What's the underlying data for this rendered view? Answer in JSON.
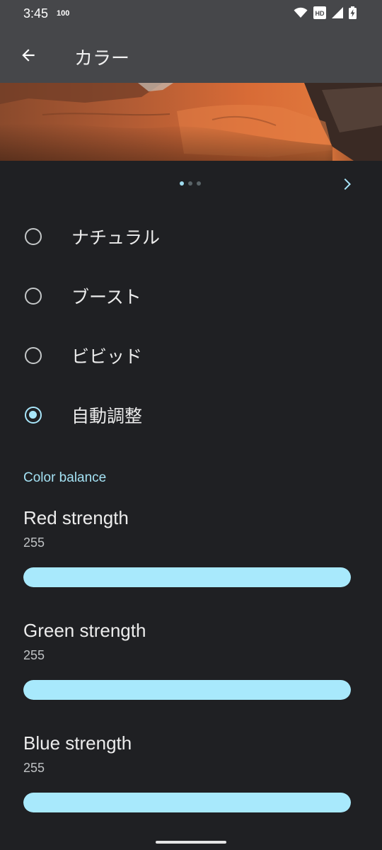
{
  "status_bar": {
    "time": "3:45",
    "battery_percent": "100",
    "icons": [
      "wifi-icon",
      "hd-icon",
      "signal-icon",
      "battery-charging-icon"
    ]
  },
  "app_bar": {
    "title": "カラー",
    "back_icon": "arrow-back-icon"
  },
  "preview": {
    "pager_dot_count": 3,
    "active_dot": 0,
    "next_icon": "chevron-right-icon"
  },
  "color_modes": {
    "options": [
      {
        "label": "ナチュラル",
        "checked": false
      },
      {
        "label": "ブースト",
        "checked": false
      },
      {
        "label": "ビビッド",
        "checked": false
      },
      {
        "label": "自動調整",
        "checked": true
      }
    ]
  },
  "color_balance": {
    "header": "Color balance",
    "max": 255,
    "sliders": [
      {
        "title": "Red strength",
        "value": "255"
      },
      {
        "title": "Green strength",
        "value": "255"
      },
      {
        "title": "Blue strength",
        "value": "255"
      }
    ]
  },
  "colors": {
    "accent": "#a8e9fc",
    "background": "#1f2023",
    "app_bar": "#46474a"
  }
}
